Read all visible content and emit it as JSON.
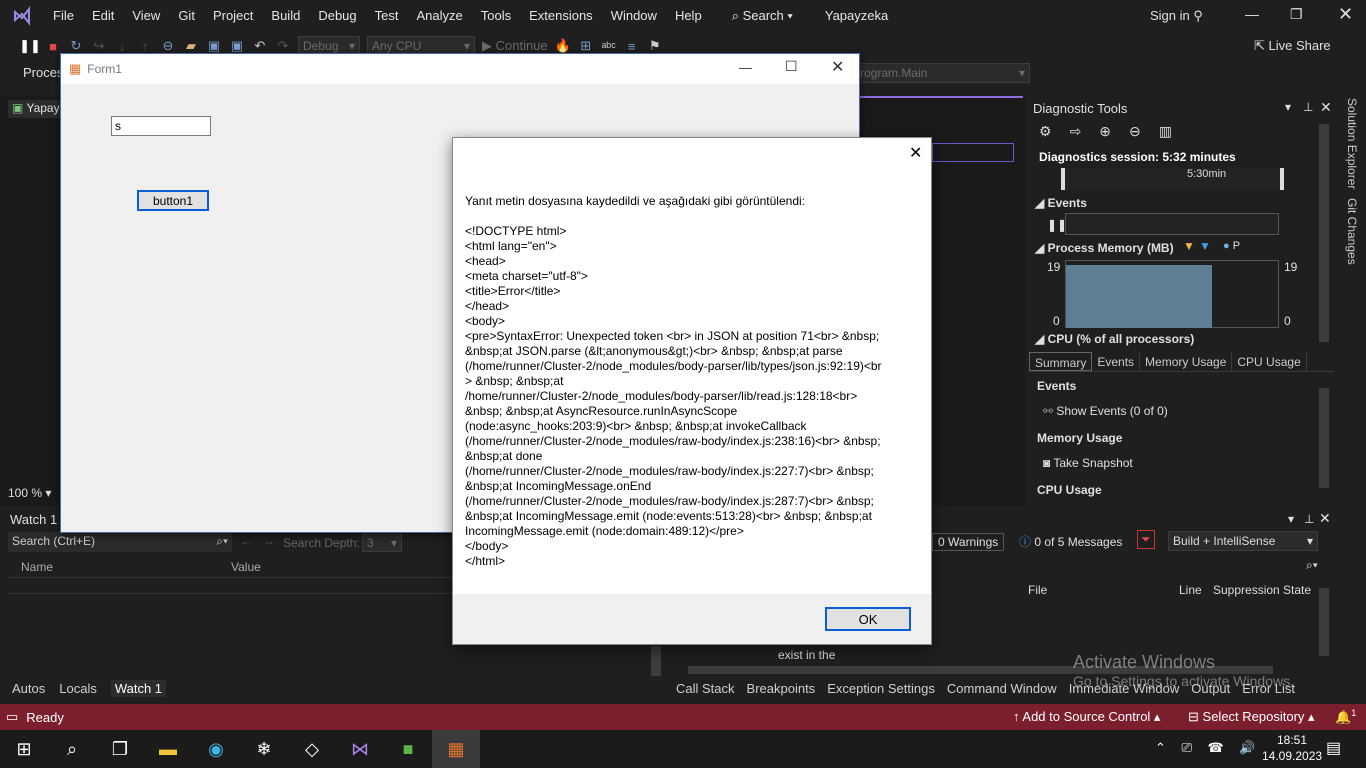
{
  "menubar": {
    "items": [
      "File",
      "Edit",
      "View",
      "Git",
      "Project",
      "Build",
      "Debug",
      "Test",
      "Analyze",
      "Tools",
      "Extensions",
      "Window",
      "Help"
    ],
    "search": "Search",
    "solution_name": "Yapayzeka",
    "sign_in": "Sign in"
  },
  "toolbar": {
    "config": "Debug",
    "platform": "Any CPU",
    "continue": "Continue",
    "live_share": "Live Share",
    "process_label": "Process:",
    "location_combo": "rogram.Main"
  },
  "doc_tab": {
    "label": "Yapayz"
  },
  "zoom": "100 %",
  "form1": {
    "title": "Form1",
    "textbox_value": "s",
    "button_label": "button1"
  },
  "dialog": {
    "message": "Yanıt metin dosyasına kaydedildi ve aşağıdaki gibi görüntülendi:\n\n<!DOCTYPE html>\n<html lang=\"en\">\n<head>\n<meta charset=\"utf-8\">\n<title>Error</title>\n</head>\n<body>\n<pre>SyntaxError: Unexpected token <br> in JSON at position 71<br> &nbsp;\n&nbsp;at JSON.parse (&lt;anonymous&gt;)<br> &nbsp; &nbsp;at parse\n(/home/runner/Cluster-2/node_modules/body-parser/lib/types/json.js:92:19)<br\n> &nbsp; &nbsp;at\n/home/runner/Cluster-2/node_modules/body-parser/lib/read.js:128:18<br>\n&nbsp; &nbsp;at AsyncResource.runInAsyncScope\n(node:async_hooks:203:9)<br> &nbsp; &nbsp;at invokeCallback\n(/home/runner/Cluster-2/node_modules/raw-body/index.js:238:16)<br> &nbsp;\n&nbsp;at done\n(/home/runner/Cluster-2/node_modules/raw-body/index.js:227:7)<br> &nbsp;\n&nbsp;at IncomingMessage.onEnd\n(/home/runner/Cluster-2/node_modules/raw-body/index.js:287:7)<br> &nbsp;\n&nbsp;at IncomingMessage.emit (node:events:513:28)<br> &nbsp; &nbsp;at\nIncomingMessage.emit (node:domain:489:12)</pre>\n</body>\n</html>",
    "ok_label": "OK"
  },
  "diagnostics": {
    "title": "Diagnostic Tools",
    "session": "Diagnostics session: 5:32 minutes",
    "timeline_label": "5:30min",
    "events_label": "Events",
    "memory_label": "Process Memory (MB)",
    "memory_legend_p": "P",
    "mem_max_left": "19",
    "mem_min_left": "0",
    "mem_max_right": "19",
    "mem_min_right": "0",
    "cpu_label": "CPU (% of all processors)",
    "tabs": [
      "Summary",
      "Events",
      "Memory Usage",
      "CPU Usage"
    ],
    "events_heading": "Events",
    "show_events": "Show Events (0 of 0)",
    "memory_heading": "Memory Usage",
    "take_snapshot": "Take Snapshot",
    "cpu_heading": "CPU Usage"
  },
  "side_tabs": [
    "Solution Explorer",
    "Git Changes"
  ],
  "watch": {
    "title": "Watch 1",
    "search": "Search (Ctrl+E)",
    "search_depth": "Search Depth:",
    "depth_value": "3",
    "col_name": "Name",
    "col_value": "Value"
  },
  "errorlist": {
    "warnings": "0 Warnings",
    "messages": "0 of 5 Messages",
    "build_filter": "Build + IntelliSense",
    "col_file": "File",
    "col_line": "Line",
    "col_suppression": "Suppression State",
    "row_text": "exist in the"
  },
  "bottom_tabs_left": [
    "Autos",
    "Locals",
    "Watch 1"
  ],
  "bottom_tabs_right": [
    "Call Stack",
    "Breakpoints",
    "Exception Settings",
    "Command Window",
    "Immediate Window",
    "Output",
    "Error List"
  ],
  "watermark": {
    "line1": "Activate Windows",
    "line2": "Go to Settings to activate Windows."
  },
  "statusbar": {
    "ready": "Ready",
    "add_source": "Add to Source Control",
    "select_repo": "Select Repository",
    "notif_count": "1"
  },
  "taskbar": {
    "time": "18:51",
    "date": "14.09.2023"
  }
}
